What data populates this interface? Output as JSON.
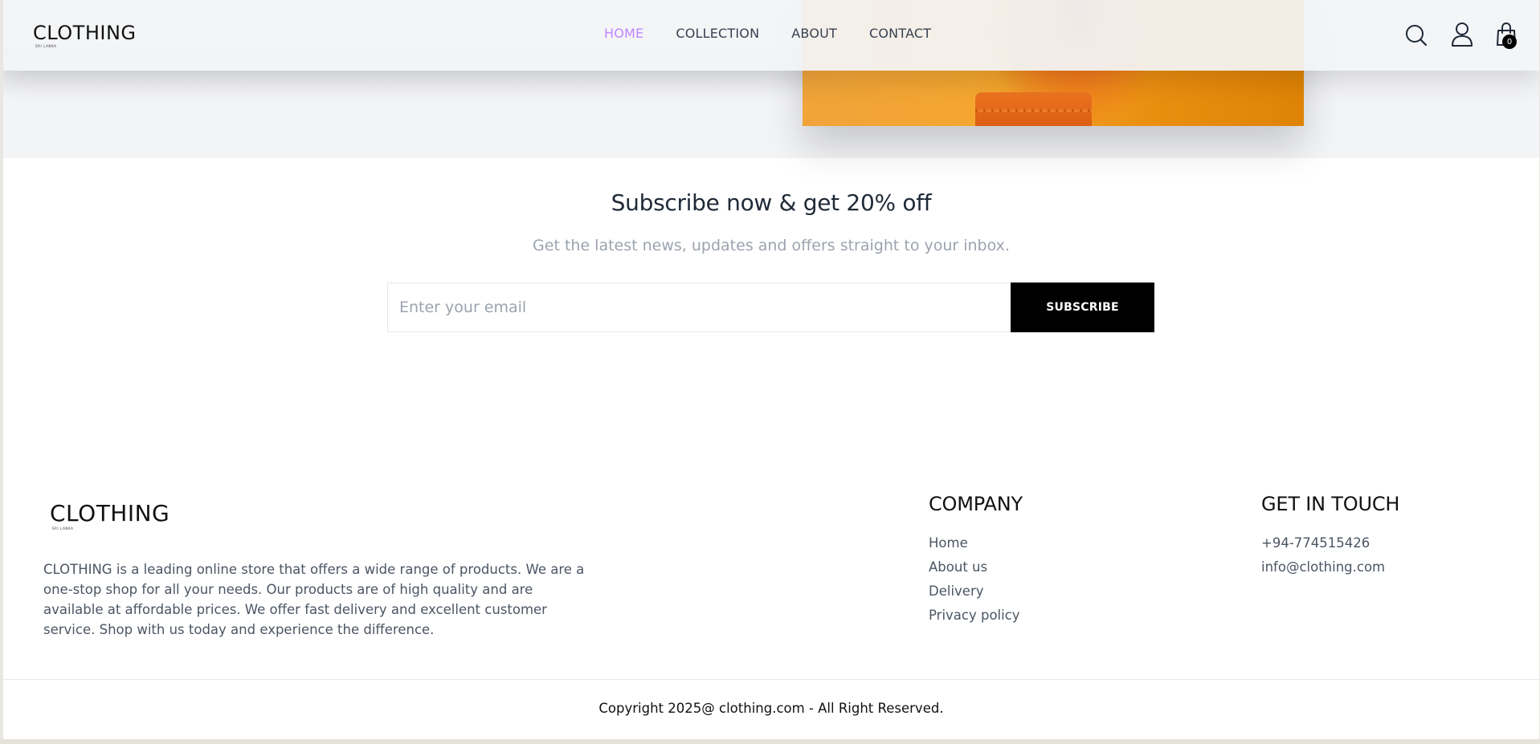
{
  "header": {
    "logo_text": "CLOTHING",
    "logo_tagline": "SRI LANKA",
    "nav": [
      {
        "label": "HOME",
        "active": true
      },
      {
        "label": "COLLECTION",
        "active": false
      },
      {
        "label": "ABOUT",
        "active": false
      },
      {
        "label": "CONTACT",
        "active": false
      }
    ],
    "icons": [
      "search-icon",
      "user-icon",
      "shopping-bag-icon"
    ],
    "cart_count": "0",
    "active_color": "#c084fc"
  },
  "subscribe": {
    "title": "Subscribe now & get 20% off",
    "subtitle": "Get the latest news, updates and offers straight to your inbox.",
    "input_placeholder": "Enter your email",
    "button_label": "SUBSCRIBE"
  },
  "footer": {
    "logo_text": "CLOTHING",
    "logo_tagline": "SRI LANKA",
    "description": "CLOTHING is a leading online store that offers a wide range of products. We are a one-stop shop for all your needs. Our products are of high quality and are available at affordable prices. We offer fast delivery and excellent customer service. Shop with us today and experience the difference.",
    "company": {
      "title": "COMPANY",
      "links": [
        "Home",
        "About us",
        "Delivery",
        "Privacy policy"
      ]
    },
    "contact": {
      "title": "GET IN TOUCH",
      "phone": "+94-774515426",
      "email": "info@clothing.com"
    },
    "copyright": "Copyright 2025@ clothing.com - All Right Reserved."
  }
}
